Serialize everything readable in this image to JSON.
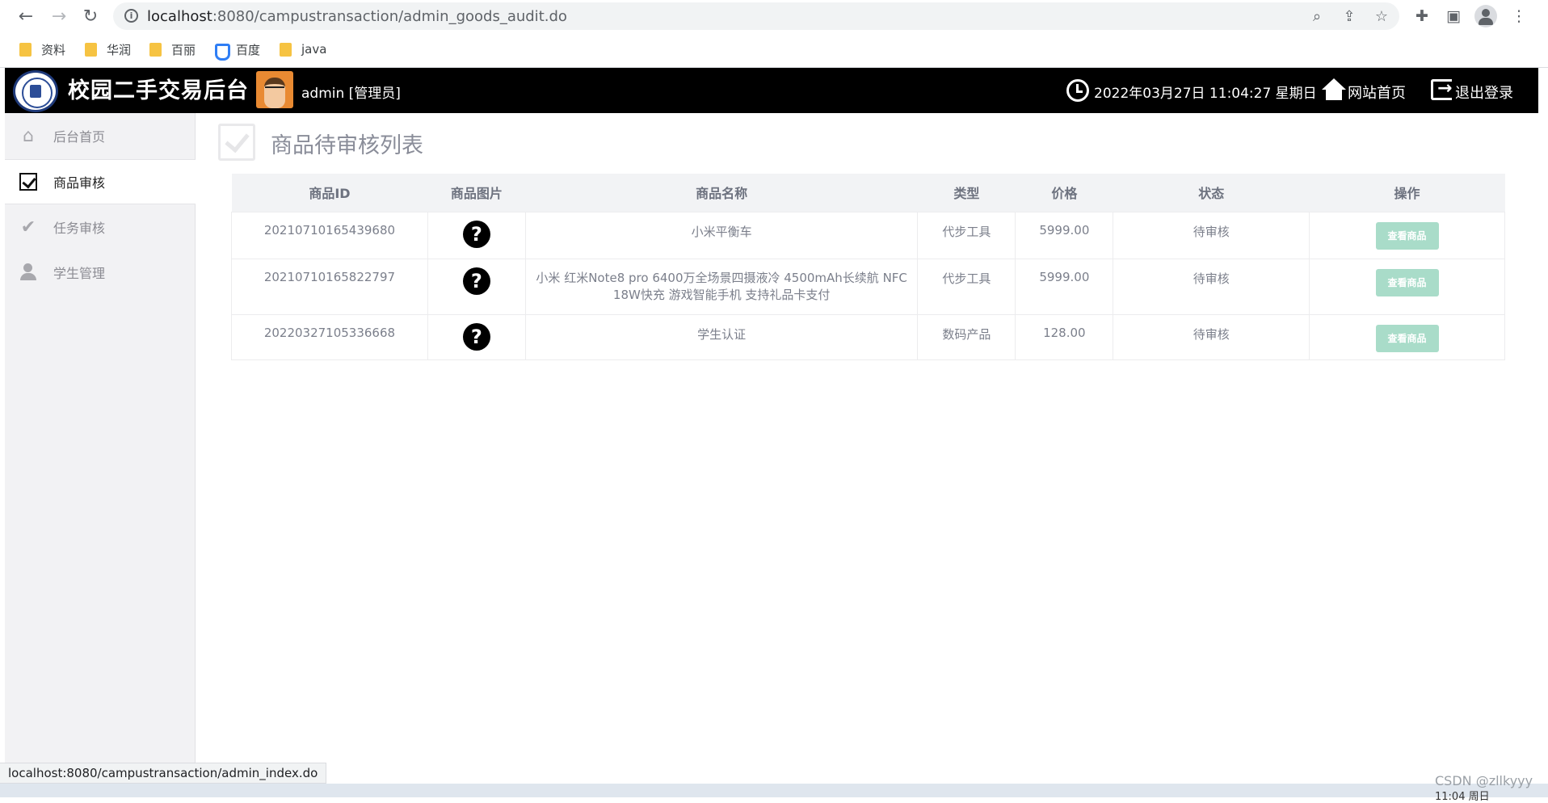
{
  "browser": {
    "url_host": "localhost",
    "url_path": ":8080/campustransaction/admin_goods_audit.do",
    "bookmarks": [
      {
        "label": "资料",
        "icon": "folder-icon"
      },
      {
        "label": "华润",
        "icon": "folder-icon"
      },
      {
        "label": "百丽",
        "icon": "folder-icon"
      },
      {
        "label": "百度",
        "icon": "baidu-icon"
      },
      {
        "label": "java",
        "icon": "folder-icon"
      }
    ],
    "status_url": "localhost:8080/campustransaction/admin_index.do"
  },
  "header": {
    "title": "校园二手交易后台",
    "user": "admin [管理员]",
    "datetime": "2022年03月27日 11:04:27 星期日",
    "site_home": "网站首页",
    "logout": "退出登录"
  },
  "sidebar": {
    "items": [
      {
        "label": "后台首页",
        "icon": "home-icon",
        "active": false
      },
      {
        "label": "商品审核",
        "icon": "checkbox-icon",
        "active": true
      },
      {
        "label": "任务审核",
        "icon": "check-icon",
        "active": false
      },
      {
        "label": "学生管理",
        "icon": "user-icon",
        "active": false
      }
    ]
  },
  "main": {
    "title": "商品待审核列表",
    "columns": [
      "商品ID",
      "商品图片",
      "商品名称",
      "类型",
      "价格",
      "状态",
      "操作"
    ],
    "rows": [
      {
        "id": "20210710165439680",
        "name": "小米平衡车",
        "type": "代步工具",
        "price": "5999.00",
        "status": "待审核",
        "action": "查看商品"
      },
      {
        "id": "20210710165822797",
        "name": "小米 红米Note8 pro 6400万全场景四摄液冷 4500mAh长续航 NFC 18W快充 游戏智能手机 支持礼品卡支付",
        "type": "代步工具",
        "price": "5999.00",
        "status": "待审核",
        "action": "查看商品"
      },
      {
        "id": "20220327105336668",
        "name": "学生认证",
        "type": "数码产品",
        "price": "128.00",
        "status": "待审核",
        "action": "查看商品"
      }
    ]
  },
  "watermark": "CSDN @zllkyyy",
  "taskbar_time": "11:04 周日"
}
